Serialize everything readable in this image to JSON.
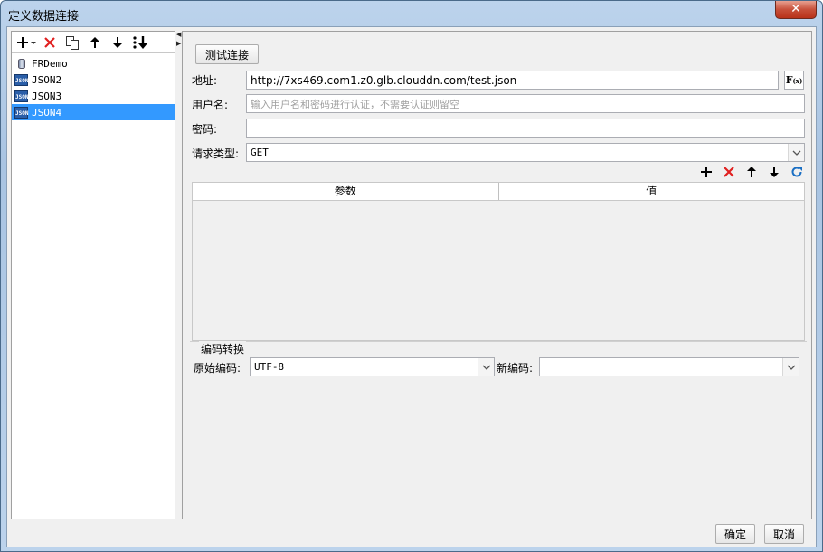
{
  "window": {
    "title": "定义数据连接",
    "close_glyph": "✕"
  },
  "left": {
    "toolbar": {
      "add": "add-icon",
      "delete": "delete-icon",
      "copy": "copy-icon",
      "up": "arrow-up-icon",
      "down": "arrow-down-icon",
      "sort": "sort-icon"
    },
    "items": [
      {
        "label": "FRDemo",
        "icon": "database-icon"
      },
      {
        "label": "JSON2",
        "icon": "json-icon"
      },
      {
        "label": "JSON3",
        "icon": "json-icon"
      },
      {
        "label": "JSON4",
        "icon": "json-icon"
      }
    ],
    "json_icon_text": "JSON"
  },
  "right": {
    "test_button": "测试连接",
    "address_label": "地址:",
    "address_value": "http://7xs469.com1.z0.glb.clouddn.com/test.json",
    "fx_label": "F",
    "fx_sub": "(x)",
    "username_label": "用户名:",
    "username_placeholder": "输入用户名和密码进行认证，不需要认证则留空",
    "password_label": "密码:",
    "password_value": "",
    "request_type_label": "请求类型:",
    "request_type_value": "GET",
    "table": {
      "columns": [
        "参数",
        "值"
      ],
      "rows": []
    },
    "encoding": {
      "group_title": "编码转换",
      "original_label": "原始编码:",
      "original_value": "UTF-8",
      "new_label": "新编码:",
      "new_value": ""
    }
  },
  "footer": {
    "ok": "确定",
    "cancel": "取消"
  },
  "colors": {
    "selection": "#3399ff",
    "delete_red": "#e02020",
    "refresh_blue": "#1a6fc4"
  }
}
